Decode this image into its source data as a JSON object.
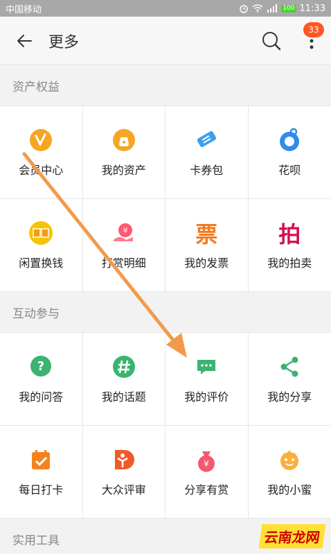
{
  "status": {
    "carrier": "中国移动",
    "battery": "100",
    "time": "11:33"
  },
  "header": {
    "title": "更多",
    "badge": "33"
  },
  "sections": [
    {
      "title": "资产权益",
      "items": [
        {
          "label": "会员中心",
          "icon": "vip-icon"
        },
        {
          "label": "我的资产",
          "icon": "money-bag-icon"
        },
        {
          "label": "卡券包",
          "icon": "coupon-icon"
        },
        {
          "label": "花呗",
          "icon": "huabei-icon"
        },
        {
          "label": "闲置换钱",
          "icon": "idle-exchange-icon"
        },
        {
          "label": "打赏明细",
          "icon": "reward-detail-icon"
        },
        {
          "label": "我的发票",
          "icon": "invoice-icon",
          "glyph": "票"
        },
        {
          "label": "我的拍卖",
          "icon": "auction-icon",
          "glyph": "拍"
        }
      ]
    },
    {
      "title": "互动参与",
      "items": [
        {
          "label": "我的问答",
          "icon": "qa-icon"
        },
        {
          "label": "我的话题",
          "icon": "topic-icon"
        },
        {
          "label": "我的评价",
          "icon": "review-icon"
        },
        {
          "label": "我的分享",
          "icon": "share-icon"
        },
        {
          "label": "每日打卡",
          "icon": "checkin-icon"
        },
        {
          "label": "大众评审",
          "icon": "public-review-icon"
        },
        {
          "label": "分享有赏",
          "icon": "share-reward-icon"
        },
        {
          "label": "我的小蜜",
          "icon": "assistant-icon"
        }
      ]
    },
    {
      "title": "实用工具",
      "items": []
    }
  ],
  "watermark": "云南龙网"
}
